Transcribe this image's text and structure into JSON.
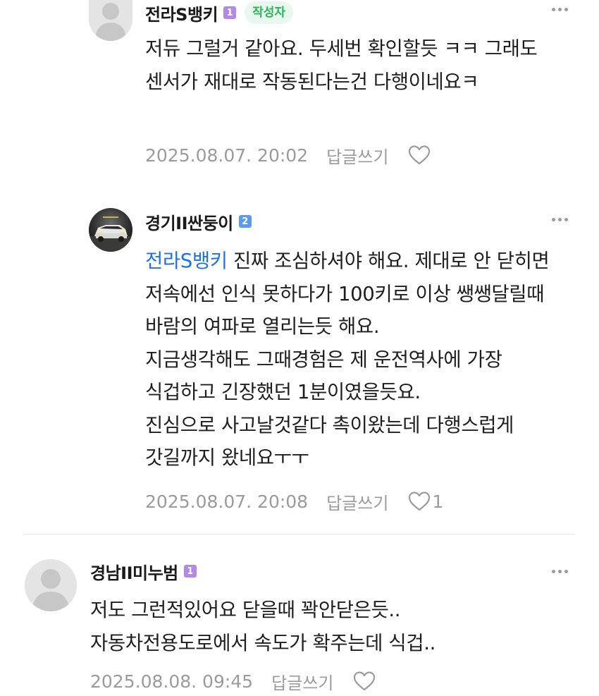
{
  "comments": [
    {
      "author": "전라S뱅키",
      "level": "1",
      "author_tag": "작성자",
      "avatar": "default-user-avatar",
      "text": "저듀 그럴거 같아요. 두세번 확인할듯 ㅋㅋ 그래도 센서가 재대로 작동된다는건 다행이네요ㅋ",
      "timestamp": "2025.08.07. 20:02",
      "reply_label": "답글쓰기",
      "like_count": ""
    },
    {
      "author": "경기II싼둥이",
      "level": "2",
      "avatar": "car-photo-avatar",
      "mention": "전라S뱅키",
      "text": " 진짜 조심하셔야 해요. 제대로 안 닫히면 저속에선 인식 못하다가 100키로 이상 쌩쌩달릴때 바람의 여파로 열리는듯 해요.",
      "text_line2": "지금생각해도 그때경험은 제 운전역사에 가장 식겁하고 긴장했던 1분이였을듯요.",
      "text_line3": "진심으로 사고날것같다 촉이왔는데 다행스럽게 갓길까지 왔네요ㅜㅜ",
      "timestamp": "2025.08.07. 20:08",
      "reply_label": "답글쓰기",
      "like_count": "1"
    },
    {
      "author": "경남II미누범",
      "level": "1",
      "avatar": "default-user-avatar",
      "text": "저도 그런적있어요 닫을때 꽉안닫은듯.. 자동차전용도로에서 속도가 확주는데 식겁..",
      "timestamp": "2025.08.08. 09:45",
      "reply_label": "답글쓰기",
      "like_count": ""
    }
  ],
  "colors": {
    "level1_badge": "#b388e8",
    "level2_badge": "#5b9bef",
    "author_tag_bg": "#e9f8ee",
    "author_tag_text": "#2bb35a",
    "mention": "#1a73e8",
    "meta_gray": "#9b9b9b"
  },
  "icons": {
    "more": "more-dots-icon",
    "like": "heart-outline-icon"
  }
}
